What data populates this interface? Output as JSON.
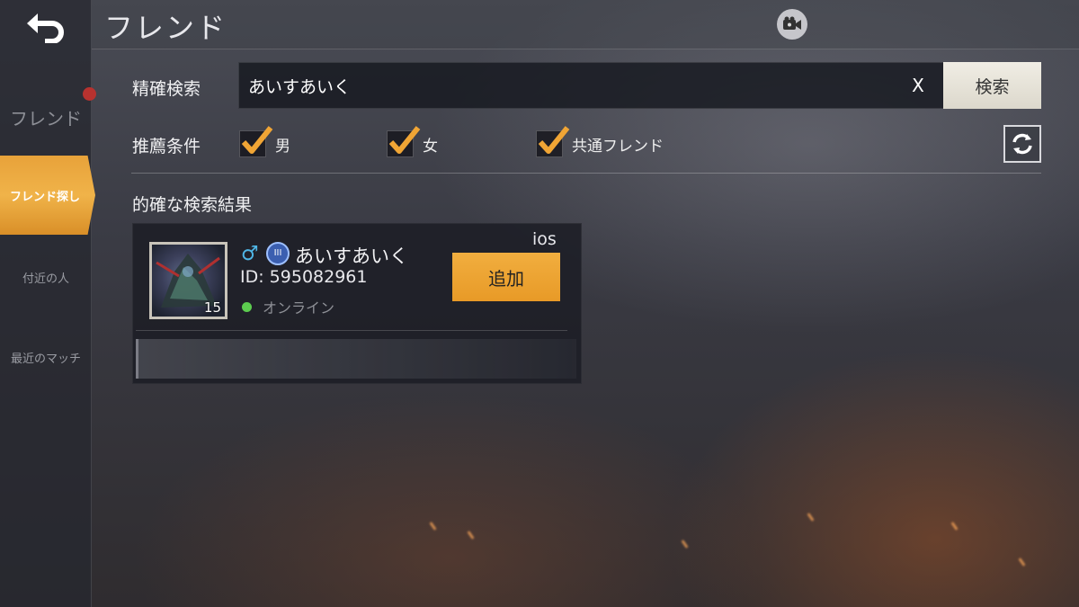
{
  "header": {
    "title": "フレンド"
  },
  "sidebar": {
    "friend_label": "フレンド",
    "items": [
      {
        "label": "フレンド探し",
        "active": true
      },
      {
        "label": "付近の人",
        "active": false
      },
      {
        "label": "最近のマッチ",
        "active": false
      }
    ]
  },
  "search": {
    "label": "精確検索",
    "value": "あいすあいく",
    "clear_label": "X",
    "button_label": "検索"
  },
  "filters": {
    "label": "推薦条件",
    "options": [
      {
        "label": "男",
        "checked": true
      },
      {
        "label": "女",
        "checked": true
      },
      {
        "label": "共通フレンド",
        "checked": true
      }
    ]
  },
  "results": {
    "heading": "的確な検索結果",
    "items": [
      {
        "gender_symbol": "♂",
        "rank_badge": "III",
        "name": "あいすあいく",
        "id_text": "ID: 595082961",
        "status": "オンライン",
        "platform": "ios",
        "level": "15",
        "add_label": "追加"
      }
    ]
  },
  "colors": {
    "accent": "#f0a535",
    "online": "#5ccc4f",
    "male": "#4fb6e6"
  }
}
